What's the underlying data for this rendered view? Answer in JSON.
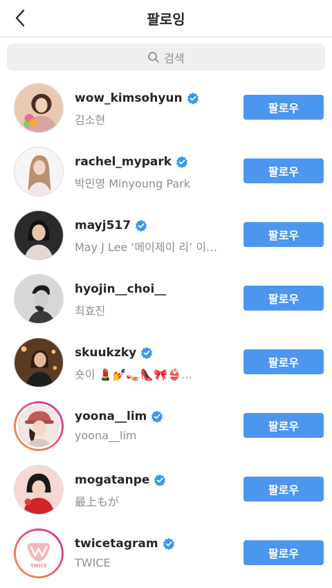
{
  "header": {
    "title": "팔로잉"
  },
  "search": {
    "placeholder": "검색"
  },
  "colors": {
    "follow": "#4d96ef",
    "verified": "#3897f0",
    "ring_start": "#d6249f",
    "ring_end": "#fd9a3e"
  },
  "follow_label": "팔로우",
  "users": [
    {
      "username": "wow_kimsohyun",
      "fullname": "김소현",
      "verified": true,
      "story_ring": false,
      "avatar": "woman-portrait-bouquet"
    },
    {
      "username": "rachel_mypark",
      "fullname": "박민영 Minyoung Park",
      "verified": true,
      "story_ring": false,
      "avatar": "woman-portrait-light"
    },
    {
      "username": "mayj517",
      "fullname": "May J Lee ‘메이제이 리’ 이…",
      "verified": true,
      "story_ring": false,
      "avatar": "woman-portrait-dark"
    },
    {
      "username": "hyojin__choi__",
      "fullname": "최효진",
      "verified": false,
      "story_ring": false,
      "avatar": "man-portrait-bw"
    },
    {
      "username": "skuukzky",
      "fullname": "숏이  💄💅👡👠🎀👙…",
      "verified": true,
      "story_ring": false,
      "avatar": "woman-portrait-bar"
    },
    {
      "username": "yoona__lim",
      "fullname": "yoona__lim",
      "verified": true,
      "story_ring": true,
      "avatar": "woman-portrait-cap"
    },
    {
      "username": "mogatanpe",
      "fullname": "最上もが",
      "verified": true,
      "story_ring": false,
      "avatar": "woman-portrait-red"
    },
    {
      "username": "twicetagram",
      "fullname": "TWICE",
      "verified": true,
      "story_ring": true,
      "avatar": "twice-logo"
    }
  ]
}
